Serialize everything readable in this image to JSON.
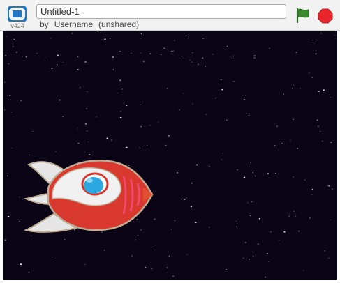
{
  "player": {
    "version": "v424",
    "title_value": "Untitled-1",
    "byline": {
      "by": "by",
      "username": "Username",
      "sharing": "(unshared)"
    }
  },
  "controls": {
    "fullscreen_icon": "fullscreen-icon",
    "green_flag_icon": "green-flag-icon",
    "stop_icon": "stop-sign-icon"
  },
  "stage": {
    "backdrop": "starfield",
    "sprite": "rocketship",
    "colors": {
      "space": "#0b0316",
      "rocket_body": "#d8382d",
      "rocket_window": "#2aa8e0",
      "flag_green": "#3a8a2e",
      "stop_red": "#e8262b"
    }
  }
}
